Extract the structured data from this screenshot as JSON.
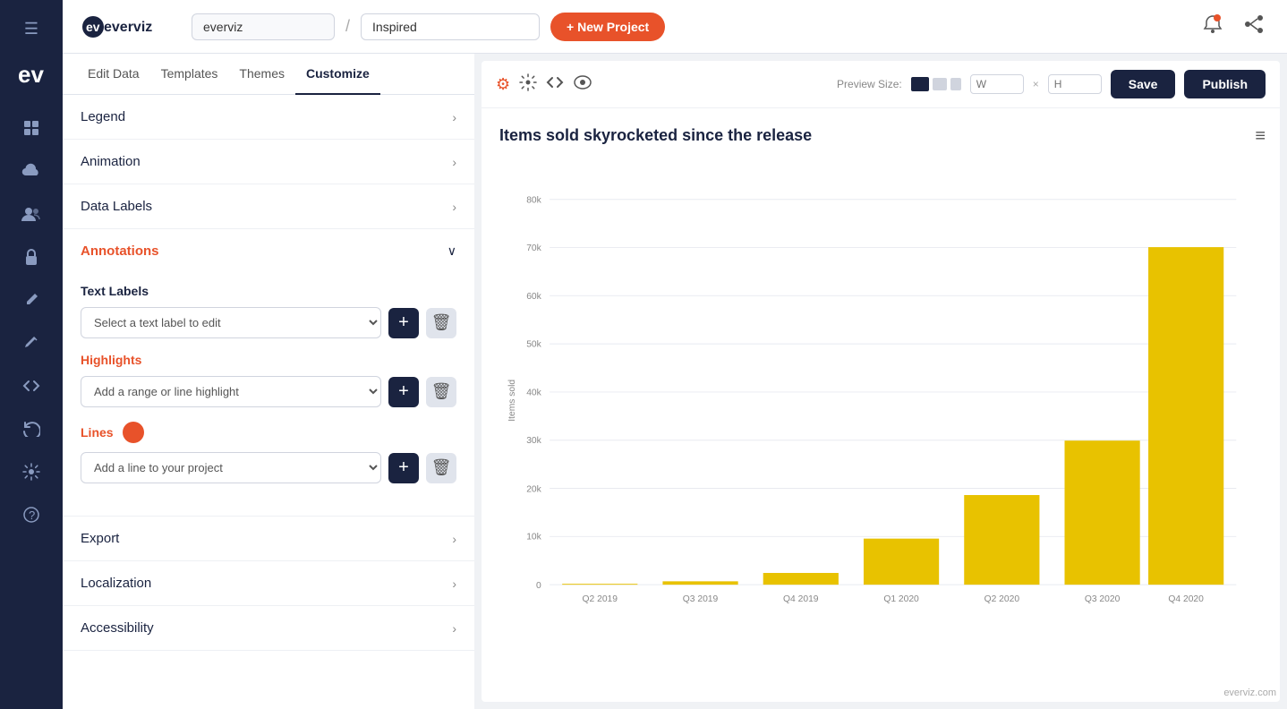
{
  "app": {
    "brand": "everviz",
    "org_name": "everviz",
    "project_name": "Inspired",
    "new_project_label": "+ New Project"
  },
  "tabs": {
    "items": [
      {
        "label": "Edit Data",
        "active": false
      },
      {
        "label": "Templates",
        "active": false
      },
      {
        "label": "Themes",
        "active": false
      },
      {
        "label": "Customize",
        "active": true
      }
    ]
  },
  "sidebar": {
    "legend_label": "Legend",
    "animation_label": "Animation",
    "data_labels_label": "Data Labels",
    "annotations_label": "Annotations",
    "export_label": "Export",
    "localization_label": "Localization",
    "accessibility_label": "Accessibility"
  },
  "annotations": {
    "text_labels_title": "Text Labels",
    "text_label_select_placeholder": "Select a text label to edit",
    "highlights_title": "Highlights",
    "highlights_select_placeholder": "Add a range or line highlight",
    "lines_title": "Lines",
    "lines_select_placeholder": "Add a line to your project"
  },
  "chart": {
    "title": "Items sold skyrocketed since the release",
    "y_axis_label": "Items sold",
    "watermark": "everviz.com",
    "bars": [
      {
        "label": "Q2 2019",
        "value": 200
      },
      {
        "label": "Q3 2019",
        "value": 600
      },
      {
        "label": "Q4 2019",
        "value": 2500
      },
      {
        "label": "Q1 2020",
        "value": 9500
      },
      {
        "label": "Q2 2020",
        "value": 18500
      },
      {
        "label": "Q3 2020",
        "value": 30000
      },
      {
        "label": "Q4 2020",
        "value": 70000
      }
    ],
    "y_ticks": [
      {
        "label": "0",
        "value": 0
      },
      {
        "label": "10k",
        "value": 10000
      },
      {
        "label": "20k",
        "value": 20000
      },
      {
        "label": "30k",
        "value": 30000
      },
      {
        "label": "40k",
        "value": 40000
      },
      {
        "label": "50k",
        "value": 50000
      },
      {
        "label": "60k",
        "value": 60000
      },
      {
        "label": "70k",
        "value": 70000
      },
      {
        "label": "80k",
        "value": 80000
      }
    ],
    "bar_color": "#e8c200",
    "max_value": 80000
  },
  "toolbar": {
    "preview_label": "Preview Size:",
    "save_label": "Save",
    "publish_label": "Publish"
  }
}
